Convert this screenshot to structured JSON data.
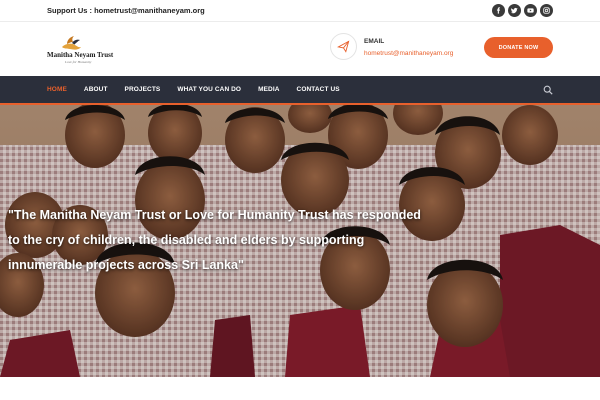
{
  "topbar": {
    "support_text": "Support Us : hometrust@manithaneyam.org",
    "social_icons": [
      "facebook-icon",
      "twitter-icon",
      "youtube-icon",
      "instagram-icon"
    ]
  },
  "header": {
    "logo_name": "Manitha Neyam Trust",
    "logo_tagline": "Love for Humanity",
    "email_label": "EMAIL",
    "email_value": "hometrust@manithaneyam.org",
    "donate_label": "DONATE NOW"
  },
  "nav": {
    "items": [
      {
        "label": "HOME",
        "active": true
      },
      {
        "label": "ABOUT",
        "active": false
      },
      {
        "label": "PROJECTS",
        "active": false
      },
      {
        "label": "WHAT YOU CAN DO",
        "active": false
      },
      {
        "label": "MEDIA",
        "active": false
      },
      {
        "label": "CONTACT US",
        "active": false
      }
    ]
  },
  "hero": {
    "quote_line1": "\"The Manitha Neyam Trust or Love for Humanity Trust has responded",
    "quote_line2": "to the cry of children, the disabled and elders by supporting",
    "quote_line3": "innumerable projects across Sri Lanka\""
  },
  "colors": {
    "accent": "#e8602c",
    "nav_bg": "#2b2f3b",
    "uniform_check": "#c9a9a9",
    "uniform_maroon": "#8a1e2e"
  }
}
